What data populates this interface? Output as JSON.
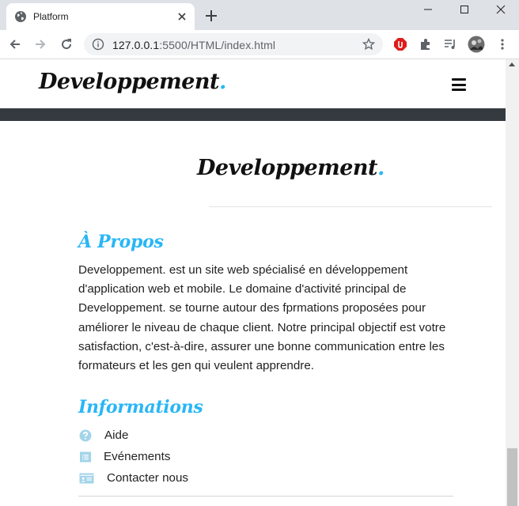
{
  "browser": {
    "tab_title": "Platform",
    "url_host": "127.0.0.1",
    "url_rest": ":5500/HTML/index.html"
  },
  "site": {
    "brand_name": "Developpement",
    "brand_dot": ".",
    "accent_color": "#29b6f6",
    "header_bar_color": "#343a40"
  },
  "footer": {
    "brand_name": "Developpement",
    "brand_dot": ".",
    "about": {
      "heading": "À Propos",
      "text": "Developpement. est un site web spécialisé en développement d'application web et mobile. Le domaine d'activité principal de Developpement. se tourne autour des fprmations proposées pour améliorer le niveau de chaque client. Notre principal objectif est votre satisfaction, c'est-à-dire, assurer une bonne communication entre les formateurs et les gen qui veulent apprendre."
    },
    "info": {
      "heading": "Informations",
      "items": [
        {
          "label": "Aide",
          "icon": "question-circle-icon"
        },
        {
          "label": "Evénements",
          "icon": "list-icon"
        },
        {
          "label": "Contacter nous",
          "icon": "id-card-icon"
        }
      ]
    }
  }
}
